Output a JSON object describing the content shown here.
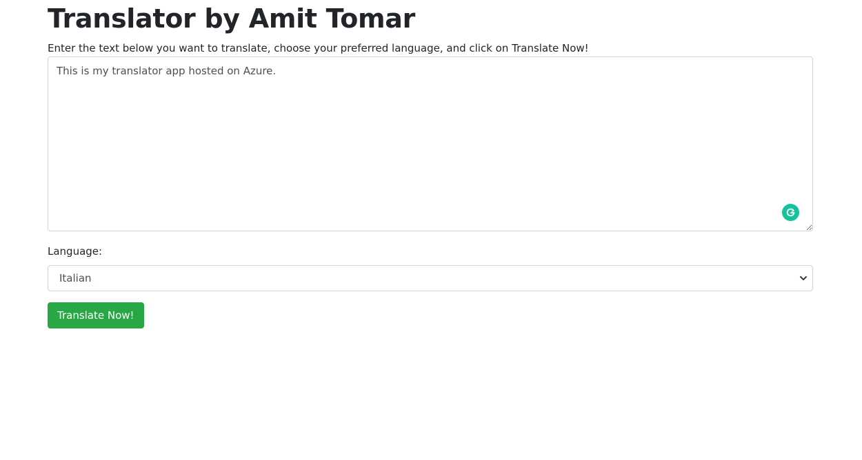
{
  "page": {
    "title": "Translator by Amit Tomar",
    "instructions": "Enter the text below you want to translate, choose your preferred language, and click on Translate Now!"
  },
  "form": {
    "text_value": "This is my translator app hosted on Azure.",
    "language_label": "Language:",
    "language_selected": "Italian",
    "submit_label": "Translate Now!"
  },
  "icons": {
    "grammarly": "grammarly-icon",
    "select_arrow": "chevron-down-icon"
  },
  "colors": {
    "submit_button": "#28a745",
    "grammarly": "#15c39a",
    "border": "#ced4da",
    "text": "#212529"
  }
}
